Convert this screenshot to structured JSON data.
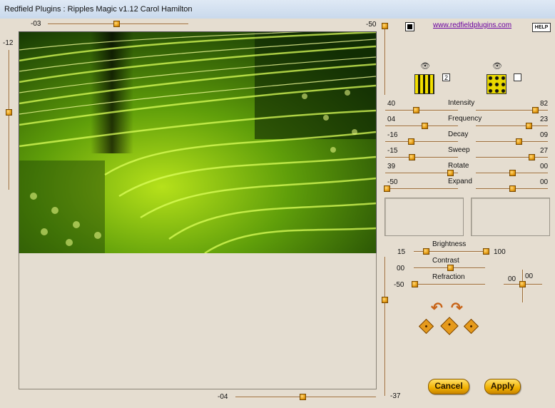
{
  "window": {
    "title": "Redfield Plugins : Ripples Magic v1.12   Carol Hamilton"
  },
  "top_slider": {
    "value": "-03"
  },
  "left_slider": {
    "value": "-12"
  },
  "bottom_slider": {
    "value": "-04"
  },
  "right_vslider": {
    "top_value": "-50",
    "bottom_value": "-37"
  },
  "header": {
    "website": "www.redfieldplugins.com",
    "help": "HELP",
    "pattern_number": "2"
  },
  "params": [
    {
      "name": "Intensity",
      "left": "40",
      "right": "82"
    },
    {
      "name": "Frequency",
      "left": "04",
      "right": "23"
    },
    {
      "name": "Decay",
      "left": "-16",
      "right": "09"
    },
    {
      "name": "Sweep",
      "left": "-15",
      "right": "27"
    },
    {
      "name": "Rotate",
      "left": "39",
      "right": "00"
    },
    {
      "name": "Expand",
      "left": "-50",
      "right": "00"
    }
  ],
  "lighting": {
    "brightness_label": "Brightness",
    "brightness_left": "15",
    "brightness_right": "100",
    "contrast_label": "Contrast",
    "contrast_value": "00",
    "refraction_label": "Refraction",
    "refraction_value": "-50",
    "light_x": "00",
    "light_y": "00"
  },
  "buttons": {
    "cancel": "Cancel",
    "apply": "Apply"
  },
  "icons": {
    "view": "eye-icon",
    "undo": "curved-arrow-left-icon",
    "redo": "curved-arrow-right-icon",
    "random": "dice-icon"
  },
  "colors": {
    "panel": "#e5ddd0",
    "knob": "#e8a21a",
    "button": "#f0b000",
    "link": "#6a00a0"
  }
}
